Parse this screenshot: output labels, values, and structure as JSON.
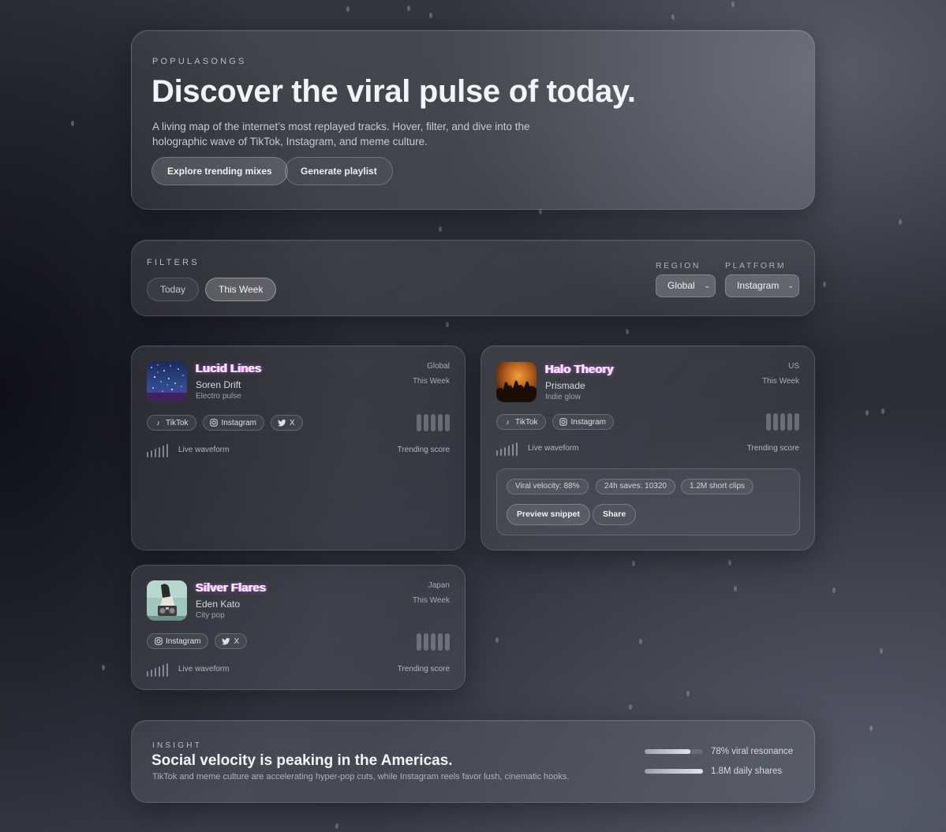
{
  "hero": {
    "eyebrow": "POPULASONGS",
    "title": "Discover the viral pulse of today.",
    "description": "A living map of the internet’s most replayed tracks. Hover, filter, and dive into the holographic wave of TikTok, Instagram, and meme culture.",
    "primary_button": "Explore trending mixes",
    "secondary_button": "Generate playlist"
  },
  "filters": {
    "eyebrow": "FILTERS",
    "periods": [
      "Today",
      "This Week"
    ],
    "active_period": "This Week",
    "region_label": "REGION",
    "region_value": "Global",
    "platform_label": "PLATFORM",
    "platform_value": "Instagram"
  },
  "tracks": [
    {
      "title": "Lucid Lines",
      "artist": "Soren Drift",
      "genre": "Electro pulse",
      "region": "Global",
      "period": "This Week",
      "tags": [
        {
          "icon": "tiktok-icon",
          "label": "TikTok"
        },
        {
          "icon": "instagram-icon",
          "label": "Instagram"
        },
        {
          "icon": "x-twitter-icon",
          "label": "X"
        }
      ],
      "wave_label": "Live waveform",
      "trend_label": "Trending score"
    },
    {
      "title": "Halo Theory",
      "artist": "Prismade",
      "genre": "Indie glow",
      "region": "US",
      "period": "This Week",
      "tags": [
        {
          "icon": "tiktok-icon",
          "label": "TikTok"
        },
        {
          "icon": "instagram-icon",
          "label": "Instagram"
        }
      ],
      "wave_label": "Live waveform",
      "trend_label": "Trending score",
      "expanded": {
        "stats": [
          "Viral velocity: 88%",
          "24h saves: 10320",
          "1.2M short clips"
        ],
        "preview_button": "Preview snippet",
        "share_button": "Share"
      }
    },
    {
      "title": "Silver Flares",
      "artist": "Eden Kato",
      "genre": "City pop",
      "region": "Japan",
      "period": "This Week",
      "tags": [
        {
          "icon": "instagram-icon",
          "label": "Instagram"
        },
        {
          "icon": "x-twitter-icon",
          "label": "X"
        }
      ],
      "wave_label": "Live waveform",
      "trend_label": "Trending score"
    }
  ],
  "insight": {
    "eyebrow": "INSIGHT",
    "title": "Social velocity is peaking in the Americas.",
    "description": "TikTok and meme culture are accelerating hyper-pop cuts, while Instagram reels favor lush, cinematic hooks.",
    "metrics": [
      {
        "label": "78% viral resonance",
        "value": 78
      },
      {
        "label": "1.8M daily shares",
        "value": 100
      }
    ]
  },
  "colors": {
    "title_glow": "#c57cff",
    "title_glow_alt": "#ff8ad6"
  }
}
